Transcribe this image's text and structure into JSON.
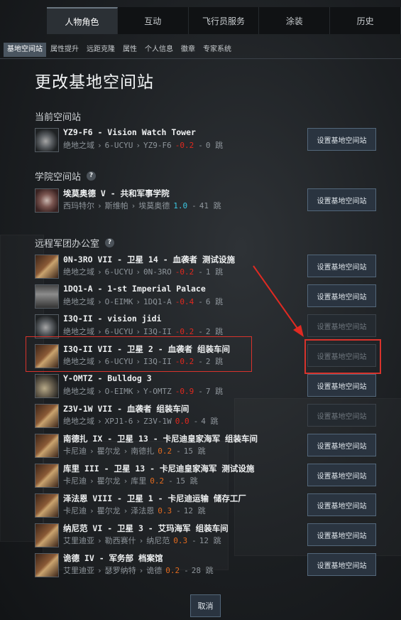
{
  "nav": {
    "tabs": [
      "人物角色",
      "互动",
      "飞行员服务",
      "涂装",
      "历史"
    ],
    "active_tab": 0,
    "subtabs": [
      "基地空间站",
      "属性提升",
      "远距克隆",
      "属性",
      "个人信息",
      "徽章",
      "专家系统"
    ],
    "active_subtab": 0
  },
  "page": {
    "title": "更改基地空间站",
    "set_label": "设置基地空间站",
    "cancel_label": "取消"
  },
  "sections": {
    "current": "当前空间站",
    "academy": "学院空间站",
    "remote": "远程军团办公室"
  },
  "help_glyph": "?",
  "stations": [
    {
      "name": "YZ9-F6 - Vision Watch Tower",
      "region": "绝地之域",
      "constellation": "6-UCYU",
      "system": "YZ9-F6",
      "sec": "-0.2",
      "sec_color": "#e0281e",
      "jumps": "0 跳"
    },
    {
      "name": "埃莫奥德 V - 共和军事学院",
      "region": "西玛特尔",
      "constellation": "斯维帕",
      "system": "埃莫奥德",
      "sec": "1.0",
      "sec_color": "#3cc7e2",
      "jumps": "41 跳"
    },
    {
      "name": "0N-3RO VII - 卫星 14 - 血袭者 测试设施",
      "region": "绝地之域",
      "constellation": "6-UCYU",
      "system": "0N-3RO",
      "sec": "-0.2",
      "sec_color": "#e0281e",
      "jumps": "1 跳"
    },
    {
      "name": "1DQ1-A - 1-st Imperial Palace",
      "region": "绝地之域",
      "constellation": "O-EIMK",
      "system": "1DQ1-A",
      "sec": "-0.4",
      "sec_color": "#e0281e",
      "jumps": "6 跳"
    },
    {
      "name": "I3Q-II - vision jidi",
      "region": "绝地之域",
      "constellation": "6-UCYU",
      "system": "I3Q-II",
      "sec": "-0.2",
      "sec_color": "#e0281e",
      "jumps": "2 跳"
    },
    {
      "name": "I3Q-II VII - 卫星 2 - 血袭者 组装车间",
      "region": "绝地之域",
      "constellation": "6-UCYU",
      "system": "I3Q-II",
      "sec": "-0.2",
      "sec_color": "#e0281e",
      "jumps": "2 跳"
    },
    {
      "name": "Y-OMTZ - Bulldog 3",
      "region": "绝地之域",
      "constellation": "O-EIMK",
      "system": "Y-OMTZ",
      "sec": "-0.9",
      "sec_color": "#e0281e",
      "jumps": "7 跳"
    },
    {
      "name": "Z3V-1W VII - 血袭者 组装车间",
      "region": "绝地之域",
      "constellation": "XPJ1-6",
      "system": "Z3V-1W",
      "sec": "0.0",
      "sec_color": "#e0281e",
      "jumps": "4 跳"
    },
    {
      "name": "南德扎 IX - 卫星 13 - 卡尼迪皇家海军 组装车间",
      "region": "卡尼迪",
      "constellation": "瞿尔龙",
      "system": "南德扎",
      "sec": "0.2",
      "sec_color": "#e26a1e",
      "jumps": "15 跳"
    },
    {
      "name": "库里 III - 卫星 13 - 卡尼迪皇家海军 测试设施",
      "region": "卡尼迪",
      "constellation": "瞿尔龙",
      "system": "库里",
      "sec": "0.2",
      "sec_color": "#e26a1e",
      "jumps": "15 跳"
    },
    {
      "name": "泽法恩 VIII - 卫星 1 - 卡尼迪运输 储存工厂",
      "region": "卡尼迪",
      "constellation": "瞿尔龙",
      "system": "泽法恩",
      "sec": "0.3",
      "sec_color": "#e26a1e",
      "jumps": "12 跳"
    },
    {
      "name": "纳尼范 VI - 卫星 3 - 艾玛海军 组装车间",
      "region": "艾里迪亚",
      "constellation": "勒西赛什",
      "system": "纳尼范",
      "sec": "0.3",
      "sec_color": "#e26a1e",
      "jumps": "12 跳"
    },
    {
      "name": "诡德 IV - 军务部 档案馆",
      "region": "艾里迪亚",
      "constellation": "瑟罗纳特",
      "system": "诡德",
      "sec": "0.2",
      "sec_color": "#e26a1e",
      "jumps": "28 跳"
    }
  ],
  "thumb_kinds": [
    "station",
    "academy",
    "office",
    "palace",
    "station",
    "office",
    "mining",
    "office",
    "office",
    "office",
    "office",
    "office",
    "office"
  ],
  "disabled_buttons": [
    4,
    5,
    7
  ],
  "separator": "›",
  "dash": "-"
}
